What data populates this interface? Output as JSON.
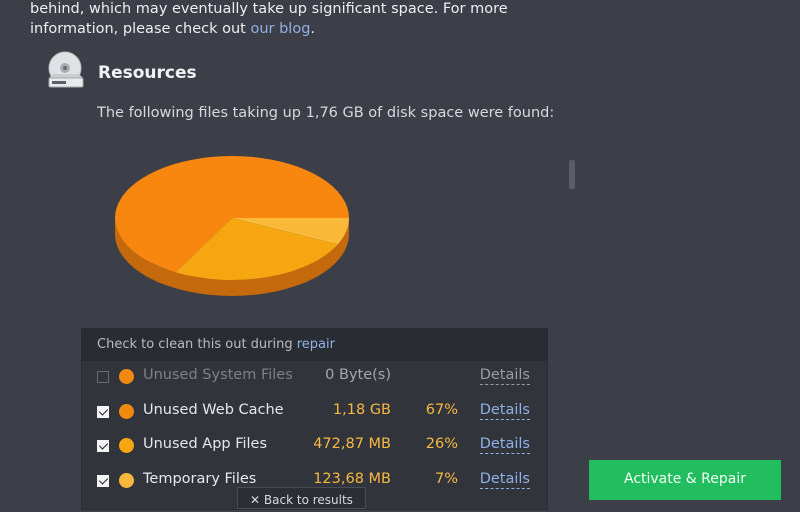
{
  "intro": {
    "line1": "behind, which may eventually take up significant space. For more",
    "line2_prefix": "information, please check out ",
    "link": "our blog",
    "line2_suffix": "."
  },
  "resources": {
    "icon": "disk-drive-icon",
    "title": "Resources",
    "found_text": "The following files taking up 1,76 GB of disk space were found:"
  },
  "panel": {
    "header_prefix": "Check to clean this out during ",
    "header_link": "repair",
    "rows": [
      {
        "checked": false,
        "disabled": true,
        "color": "#f08a0f",
        "name": "Unused System Files",
        "size": "0 Byte(s)",
        "pct": "",
        "details": "Details"
      },
      {
        "checked": true,
        "disabled": false,
        "color": "#f08a0f",
        "name": "Unused Web Cache",
        "size": "1,18 GB",
        "pct": "67%",
        "details": "Details"
      },
      {
        "checked": true,
        "disabled": false,
        "color": "#f5a611",
        "name": "Unused App Files",
        "size": "472,87 MB",
        "pct": "26%",
        "details": "Details"
      },
      {
        "checked": true,
        "disabled": false,
        "color": "#f8b73c",
        "name": "Temporary Files",
        "size": "123,68 MB",
        "pct": "7%",
        "details": "Details"
      }
    ]
  },
  "buttons": {
    "back": "✕ Back to results",
    "activate": "Activate & Repair"
  },
  "chart_data": {
    "type": "pie",
    "title": "",
    "categories": [
      "Unused System Files",
      "Unused Web Cache",
      "Unused App Files",
      "Temporary Files"
    ],
    "values": [
      0,
      67,
      26,
      7
    ],
    "colors": [
      "#f08a0f",
      "#f7870f",
      "#f5a611",
      "#fbb93a"
    ],
    "style": "3d"
  }
}
